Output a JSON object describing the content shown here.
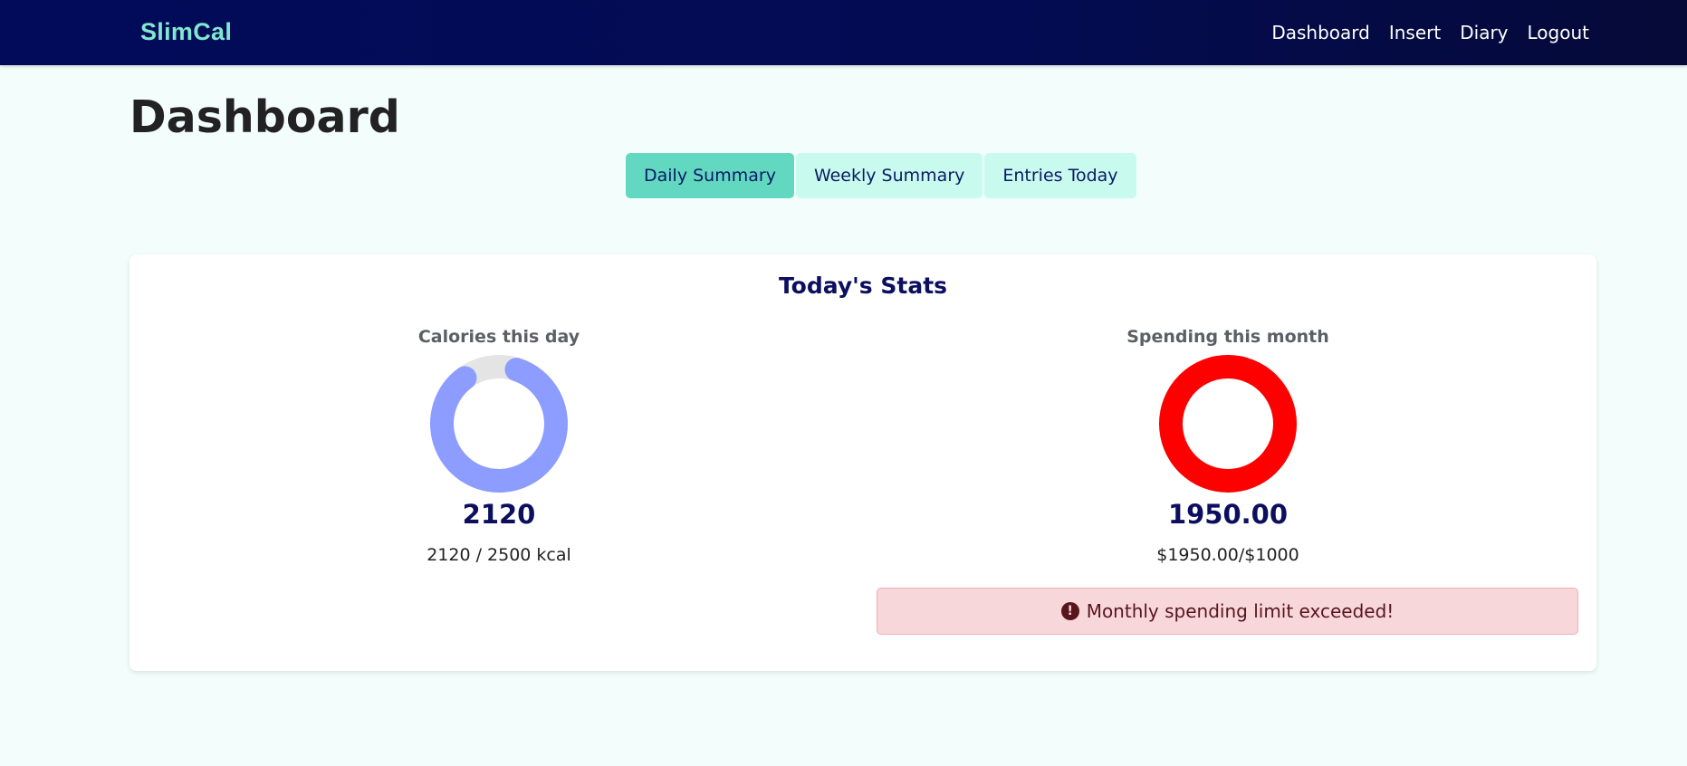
{
  "navbar": {
    "brand": "SlimCal",
    "links": [
      "Dashboard",
      "Insert",
      "Diary",
      "Logout"
    ]
  },
  "page": {
    "title": "Dashboard"
  },
  "tabs": [
    {
      "label": "Daily Summary",
      "active": true
    },
    {
      "label": "Weekly Summary",
      "active": false
    },
    {
      "label": "Entries Today",
      "active": false
    }
  ],
  "stats": {
    "title": "Today's Stats",
    "calories": {
      "label": "Calories this day",
      "value": "2120",
      "sub": "2120 / 2500 kcal",
      "current": 2120,
      "limit": 2500,
      "color": "#8c9cff",
      "track_color": "#e4e4e4"
    },
    "spending": {
      "label": "Spending this month",
      "value": "1950.00",
      "sub": "$1950.00/$1000",
      "current": 1950,
      "limit": 1000,
      "color": "#ff0000",
      "track_color": "#e4e4e4"
    },
    "alert": {
      "icon": "exclamation-circle-icon",
      "text": "Monthly spending limit exceeded!"
    }
  }
}
